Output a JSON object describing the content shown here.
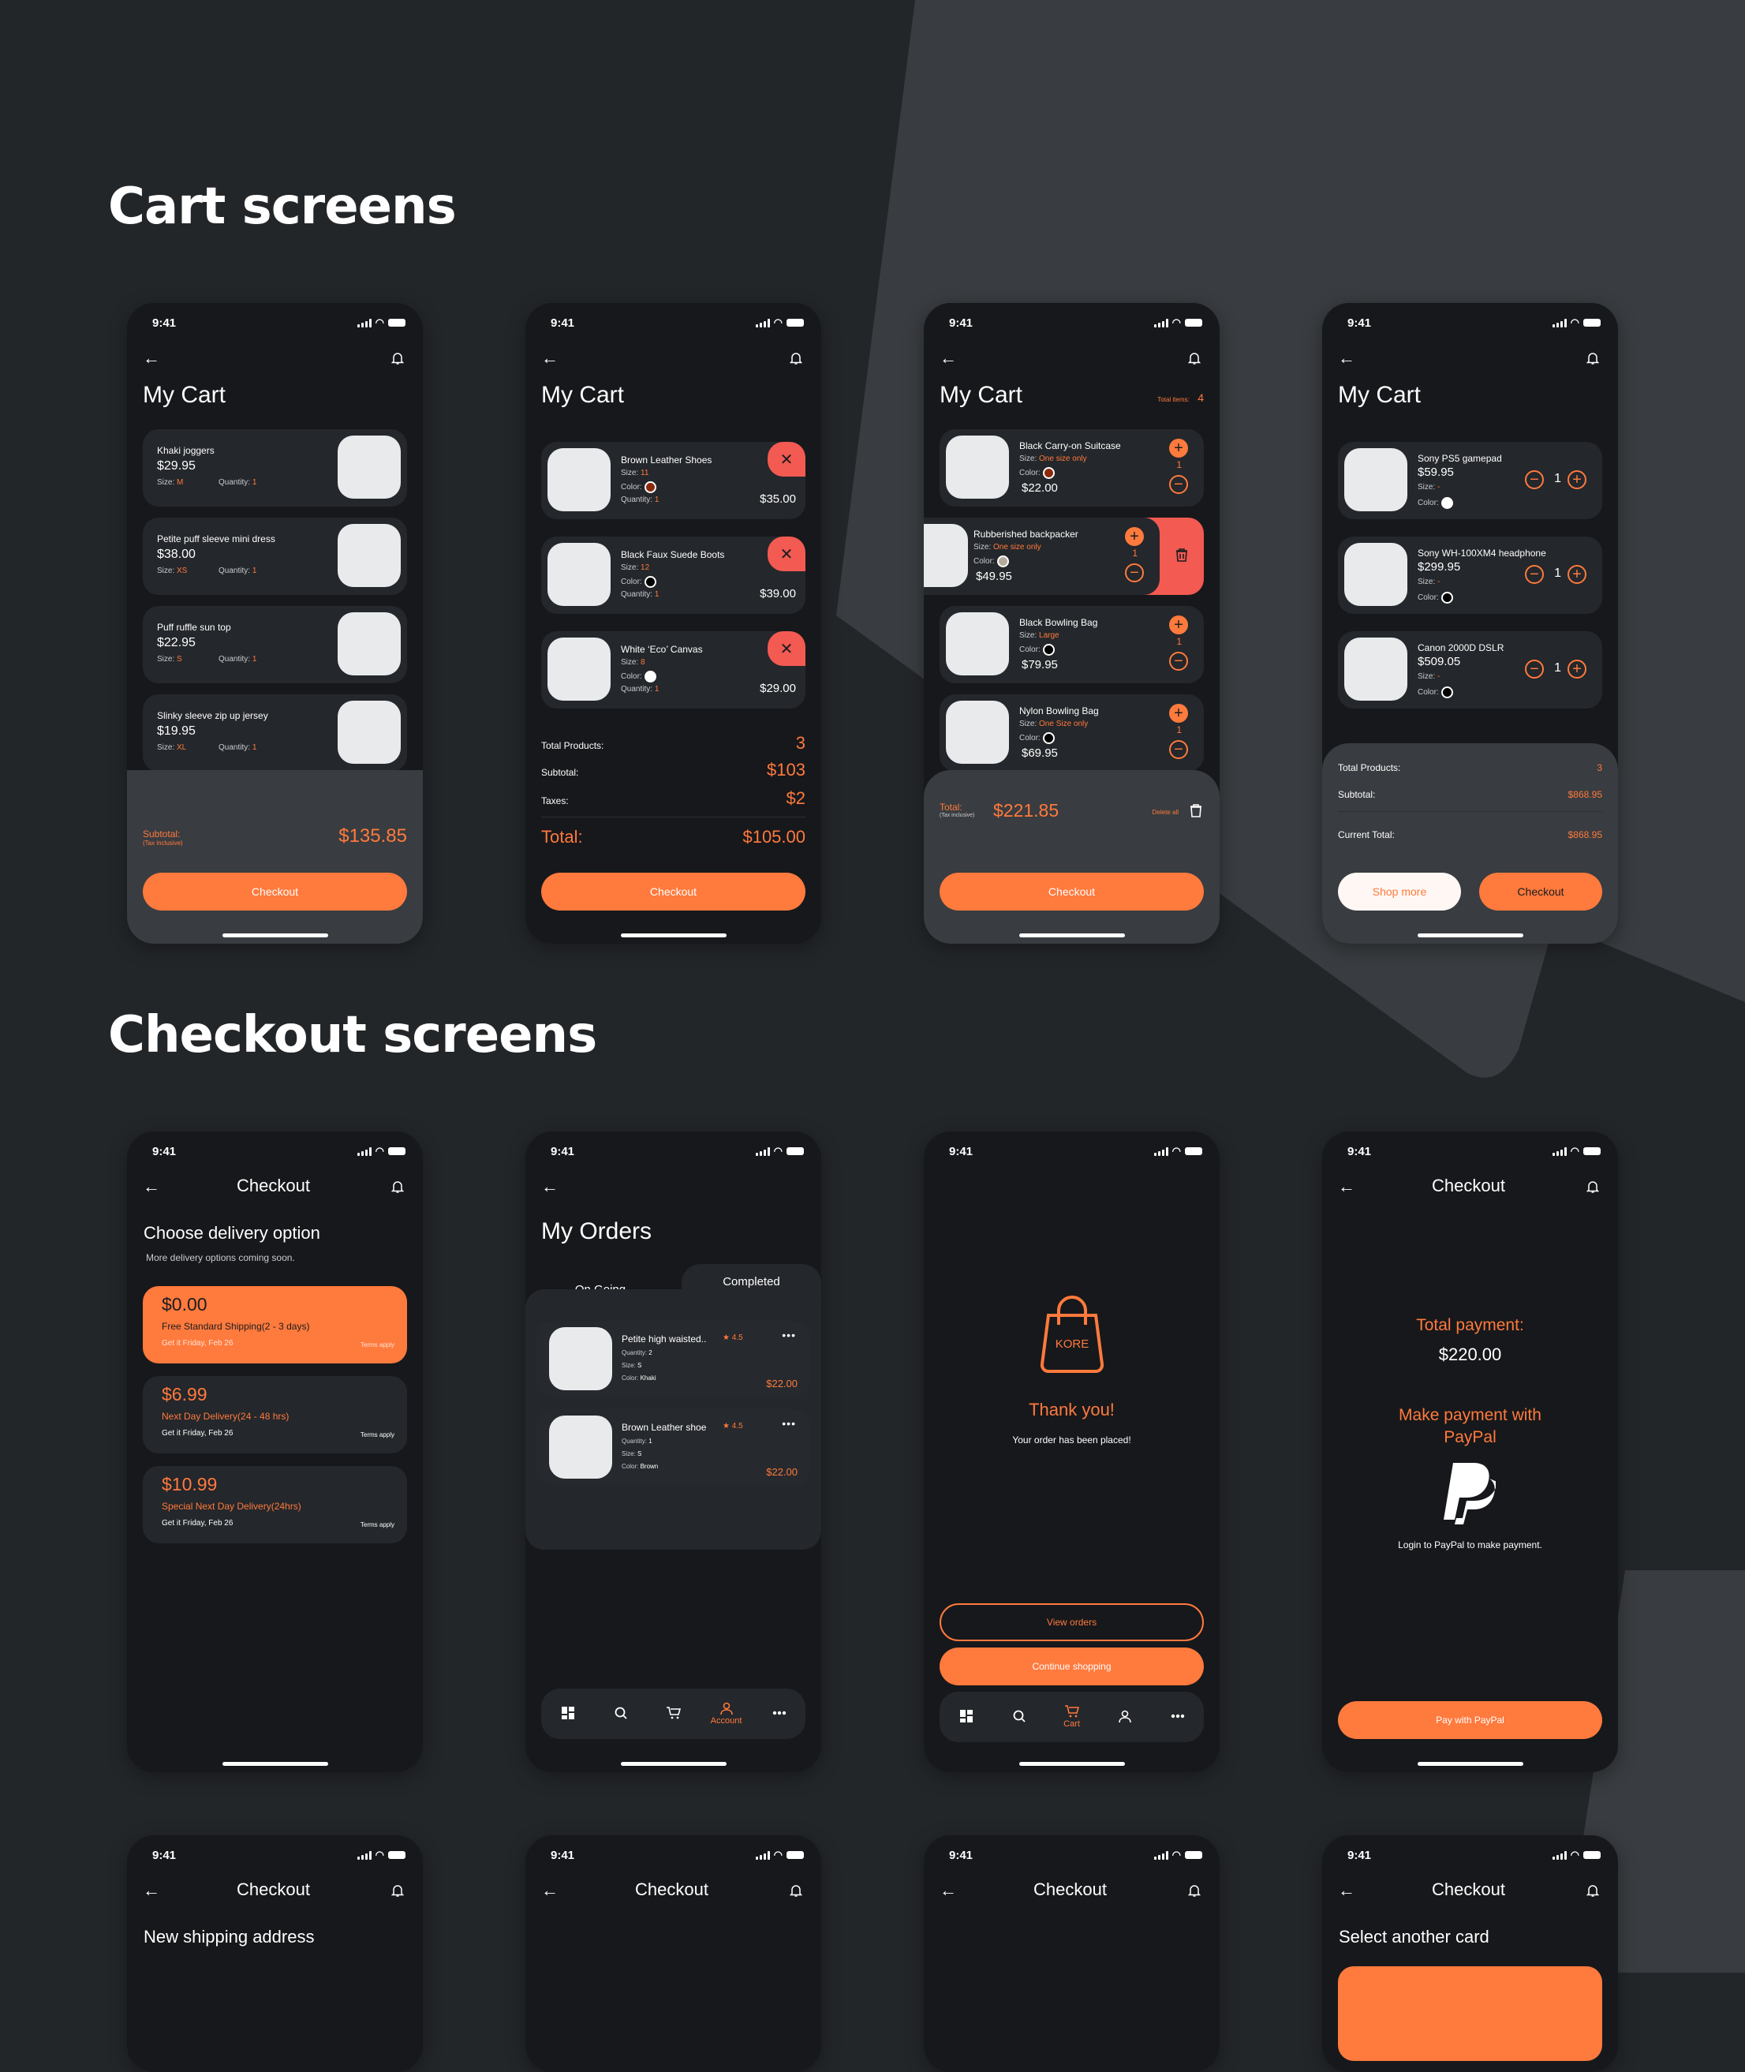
{
  "sections": {
    "cart": "Cart screens",
    "checkout": "Checkout screens"
  },
  "status": {
    "time": "9:41"
  },
  "colors": {
    "accent": "#ff7a3d",
    "danger": "#f25a52",
    "bg": "#17181b",
    "card": "#24272b"
  },
  "cart1": {
    "title": "My Cart",
    "items": [
      {
        "name": "Khaki joggers",
        "price": "$29.95",
        "size_label": "Size:",
        "size": "M",
        "qty_label": "Quantity:",
        "qty": "1"
      },
      {
        "name": "Petite puff sleeve mini dress",
        "price": "$38.00",
        "size_label": "Size:",
        "size": "XS",
        "qty_label": "Quantity:",
        "qty": "1"
      },
      {
        "name": "Puff ruffle sun top",
        "price": "$22.95",
        "size_label": "Size:",
        "size": "S",
        "qty_label": "Quantity:",
        "qty": "1"
      },
      {
        "name": "Slinky sleeve zip up jersey",
        "price": "$19.95",
        "size_label": "Size:",
        "size": "XL",
        "qty_label": "Quantity:",
        "qty": "1"
      }
    ],
    "subtotal_label": "Subtotal:",
    "tax_note": "(Tax inclusive)",
    "subtotal": "$135.85",
    "checkout": "Checkout"
  },
  "cart2": {
    "title": "My Cart",
    "items": [
      {
        "name": "Brown Leather Shoes",
        "size": "11",
        "color": "#8a2a0c",
        "qty": "1",
        "price": "$35.00"
      },
      {
        "name": "Black Faux Suede Boots",
        "size": "12",
        "color": "#000000",
        "qty": "1",
        "price": "$39.00"
      },
      {
        "name": "White ‘Eco’ Canvas",
        "size": "8",
        "color": "#ffffff",
        "qty": "1",
        "price": "$29.00"
      }
    ],
    "labels": {
      "size": "Size:",
      "color": "Color:",
      "qty": "Quantity:"
    },
    "total_products_label": "Total Products:",
    "total_products": "3",
    "subtotal_label": "Subtotal:",
    "subtotal": "$103",
    "taxes_label": "Taxes:",
    "taxes": "$2",
    "total_label": "Total:",
    "total": "$105.00",
    "checkout": "Checkout"
  },
  "cart3": {
    "title": "My Cart",
    "total_items_label": "Total items:",
    "total_items": "4",
    "items": [
      {
        "name": "Black Carry-on Suitcase",
        "size": "One size only",
        "color": "#8a2a0c",
        "price": "$22.00",
        "qty": "1"
      },
      {
        "name": "Rubberished backpacker",
        "size": "One size only",
        "color": "#b5ab9c",
        "price": "$49.95",
        "qty": "1"
      },
      {
        "name": "Black Bowling Bag",
        "size": "Large",
        "color": "#000000",
        "price": "$79.95",
        "qty": "1"
      },
      {
        "name": "Nylon Bowling Bag",
        "size": "One Size only",
        "color": "#000000",
        "price": "$69.95",
        "qty": "1"
      }
    ],
    "labels": {
      "size": "Size:",
      "color": "Color:"
    },
    "total_label": "Total:",
    "tax_note": "(Tax inclusive)",
    "total": "$221.85",
    "delete_all": "Delete all",
    "checkout": "Checkout"
  },
  "cart4": {
    "title": "My Cart",
    "items": [
      {
        "name": "Sony PS5 gamepad",
        "price": "$59.95",
        "size": "-",
        "color": "#ffffff",
        "qty": "1"
      },
      {
        "name": "Sony WH-100XM4 headphone",
        "price": "$299.95",
        "size": "-",
        "color": "#000000",
        "qty": "1"
      },
      {
        "name": "Canon 2000D DSLR",
        "price": "$509.05",
        "size": "-",
        "color": "#000000",
        "qty": "1"
      }
    ],
    "labels": {
      "size": "Size:",
      "color": "Color:"
    },
    "total_products_label": "Total Products:",
    "total_products": "3",
    "subtotal_label": "Subtotal:",
    "subtotal": "$868.95",
    "current_total_label": "Current Total:",
    "current_total": "$868.95",
    "shop_more": "Shop more",
    "checkout": "Checkout"
  },
  "delivery": {
    "nav_title": "Checkout",
    "heading": "Choose delivery option",
    "sub": "More delivery options coming soon.",
    "options": [
      {
        "price": "$0.00",
        "name": "Free Standard Shipping(2 - 3 days)",
        "eta": "Get it Friday, Feb 26",
        "terms": "Terms apply",
        "selected": true
      },
      {
        "price": "$6.99",
        "name": "Next Day Delivery(24 - 48 hrs)",
        "eta": "Get it Friday, Feb 26",
        "terms": "Terms apply",
        "selected": false
      },
      {
        "price": "$10.99",
        "name": "Special Next Day Delivery(24hrs)",
        "eta": "Get it Friday, Feb 26",
        "terms": "Terms apply",
        "selected": false
      }
    ]
  },
  "orders": {
    "title": "My Orders",
    "tabs": [
      "On Going",
      "Completed"
    ],
    "active_tab": "Completed",
    "items": [
      {
        "name": "Petite high waisted..",
        "rating": "4.5",
        "qty_label": "Quantity:",
        "qty": "2",
        "size_label": "Size:",
        "size": "S",
        "color_label": "Color:",
        "color": "Khaki",
        "price": "$22.00"
      },
      {
        "name": "Brown Leather shoe",
        "rating": "4.5",
        "qty_label": "Quantity:",
        "qty": "1",
        "size_label": "Size:",
        "size": "S",
        "color_label": "Color:",
        "color": "Brown",
        "price": "$22.00"
      }
    ],
    "tabbar": [
      {
        "icon": "grid-icon",
        "label": ""
      },
      {
        "icon": "search-icon",
        "label": ""
      },
      {
        "icon": "cart-icon",
        "label": ""
      },
      {
        "icon": "account-icon",
        "label": "Account",
        "active": true
      },
      {
        "icon": "more-icon",
        "label": ""
      }
    ]
  },
  "thanks": {
    "brand": "KORE",
    "title": "Thank you!",
    "sub": "Your order has been placed!",
    "view_orders": "View orders",
    "continue": "Continue shopping",
    "tabbar": [
      {
        "icon": "grid-icon",
        "label": ""
      },
      {
        "icon": "search-icon",
        "label": ""
      },
      {
        "icon": "cart-icon",
        "label": "Cart",
        "active": true
      },
      {
        "icon": "account-icon",
        "label": ""
      },
      {
        "icon": "more-icon",
        "label": ""
      }
    ]
  },
  "paypal": {
    "nav_title": "Checkout",
    "total_label": "Total payment:",
    "total": "$220.00",
    "heading": "Make payment with PayPal",
    "note": "Login to PayPal to make payment.",
    "button": "Pay with PayPal"
  },
  "row3": [
    {
      "nav_title": "Checkout",
      "heading": "New shipping address"
    },
    {
      "nav_title": "Checkout",
      "heading": ""
    },
    {
      "nav_title": "Checkout",
      "heading": ""
    },
    {
      "nav_title": "Checkout",
      "heading": "Select another card"
    }
  ]
}
